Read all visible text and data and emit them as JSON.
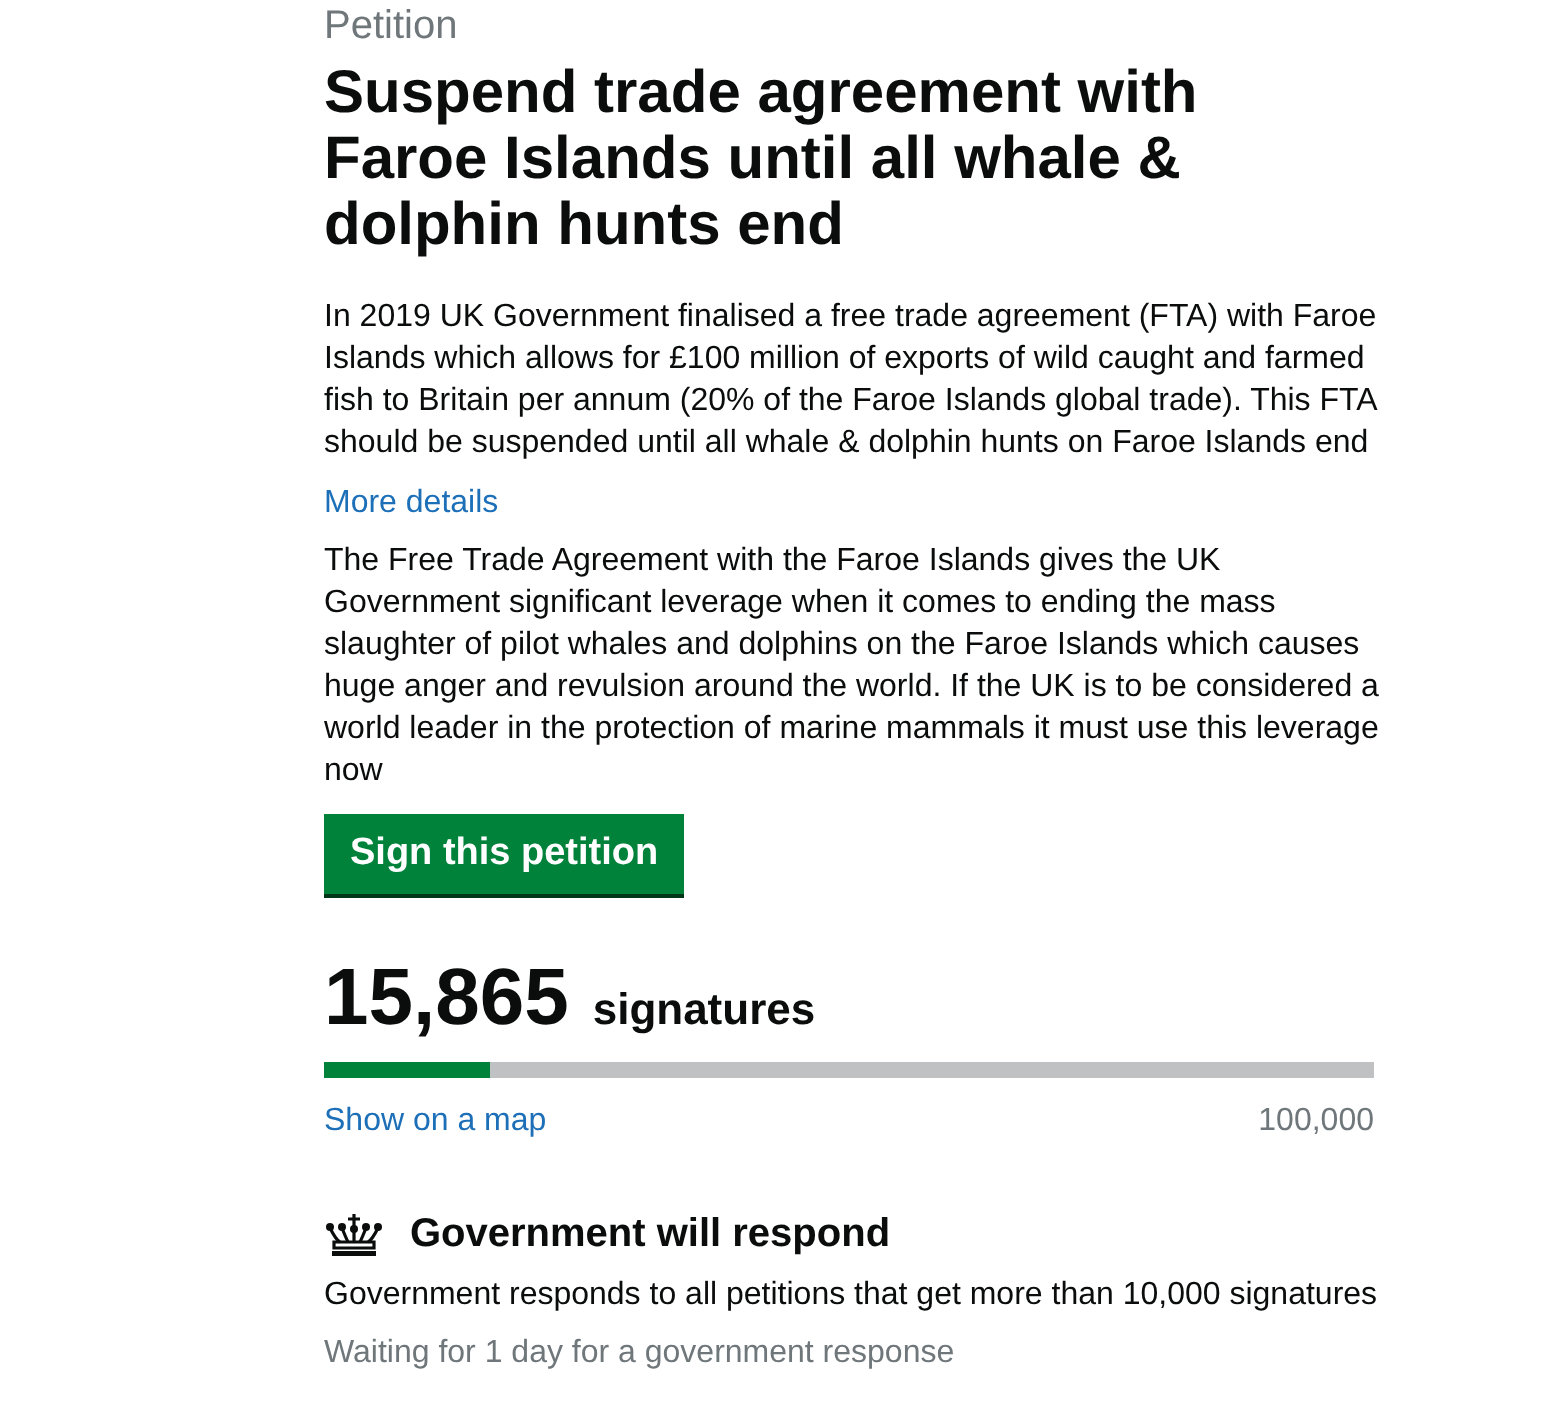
{
  "header": {
    "kicker": "Petition",
    "title": "Suspend trade agreement with Faroe Islands until all whale & dolphin hunts end"
  },
  "summary": "In 2019 UK Government finalised a free trade agreement (FTA) with Faroe Islands which allows for £100 million of exports of wild caught and farmed fish to Britain per annum (20% of the Faroe Islands global trade). This FTA should be suspended until all whale & dolphin hunts on Faroe Islands end",
  "details": {
    "link": "More details",
    "text": "The Free Trade Agreement with the Faroe Islands gives the UK Government significant leverage when it comes to ending the mass slaughter of pilot whales and dolphins on the Faroe Islands which causes huge anger and revulsion around the world. If the UK is to be considered a world leader in the protection of marine mammals it must use this leverage now"
  },
  "sign_button": "Sign this petition",
  "signatures": {
    "count": "15,865",
    "label": "signatures",
    "level": 0.159,
    "map_link": "Show on a map",
    "target": "100,000"
  },
  "response": {
    "title": "Government will respond",
    "text": "Government responds to all petitions that get more than 10,000 signatures",
    "status": "Waiting for 1 day for a government response"
  }
}
